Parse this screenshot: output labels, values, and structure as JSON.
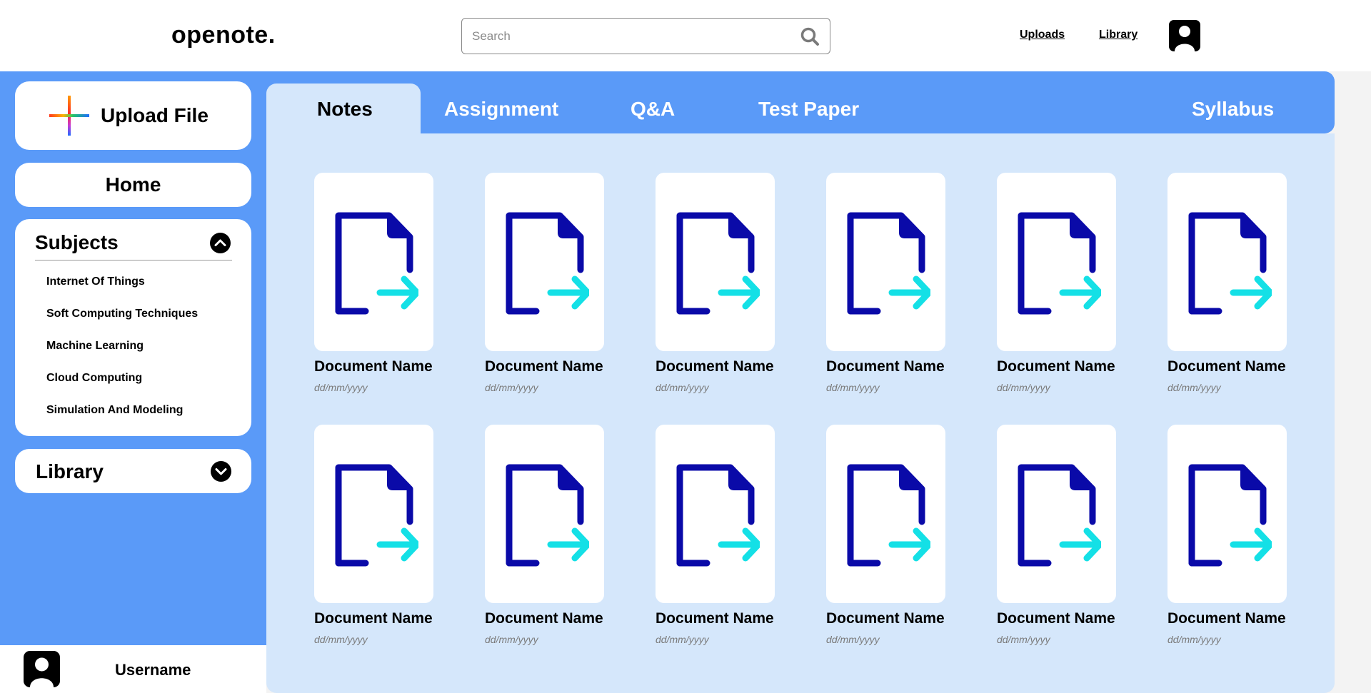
{
  "header": {
    "logo": "openote.",
    "search_placeholder": "Search",
    "nav": [
      {
        "label": "Uploads"
      },
      {
        "label": "Library"
      }
    ]
  },
  "sidebar": {
    "upload_label": "Upload File",
    "home_label": "Home",
    "subjects": {
      "title": "Subjects",
      "items": [
        {
          "label": "Internet Of Things"
        },
        {
          "label": "Soft Computing Techniques"
        },
        {
          "label": "Machine Learning"
        },
        {
          "label": "Cloud Computing"
        },
        {
          "label": "Simulation And Modeling"
        }
      ]
    },
    "library_title": "Library",
    "username": "Username"
  },
  "tabs": [
    {
      "label": "Notes",
      "active": true
    },
    {
      "label": "Assignment"
    },
    {
      "label": "Q&A"
    },
    {
      "label": "Test Paper"
    },
    {
      "label": "Syllabus"
    }
  ],
  "documents": [
    {
      "name": "Document Name",
      "date": "dd/mm/yyyy"
    },
    {
      "name": "Document Name",
      "date": "dd/mm/yyyy"
    },
    {
      "name": "Document Name",
      "date": "dd/mm/yyyy"
    },
    {
      "name": "Document Name",
      "date": "dd/mm/yyyy"
    },
    {
      "name": "Document Name",
      "date": "dd/mm/yyyy"
    },
    {
      "name": "Document Name",
      "date": "dd/mm/yyyy"
    },
    {
      "name": "Document Name",
      "date": "dd/mm/yyyy"
    },
    {
      "name": "Document Name",
      "date": "dd/mm/yyyy"
    },
    {
      "name": "Document Name",
      "date": "dd/mm/yyyy"
    },
    {
      "name": "Document Name",
      "date": "dd/mm/yyyy"
    },
    {
      "name": "Document Name",
      "date": "dd/mm/yyyy"
    },
    {
      "name": "Document Name",
      "date": "dd/mm/yyyy"
    }
  ],
  "colors": {
    "accent_blue": "#5a9af8",
    "panel_light_blue": "#d5e7fb",
    "doc_icon_navy": "#0a0aa8",
    "doc_icon_arrow": "#14e0e6"
  }
}
